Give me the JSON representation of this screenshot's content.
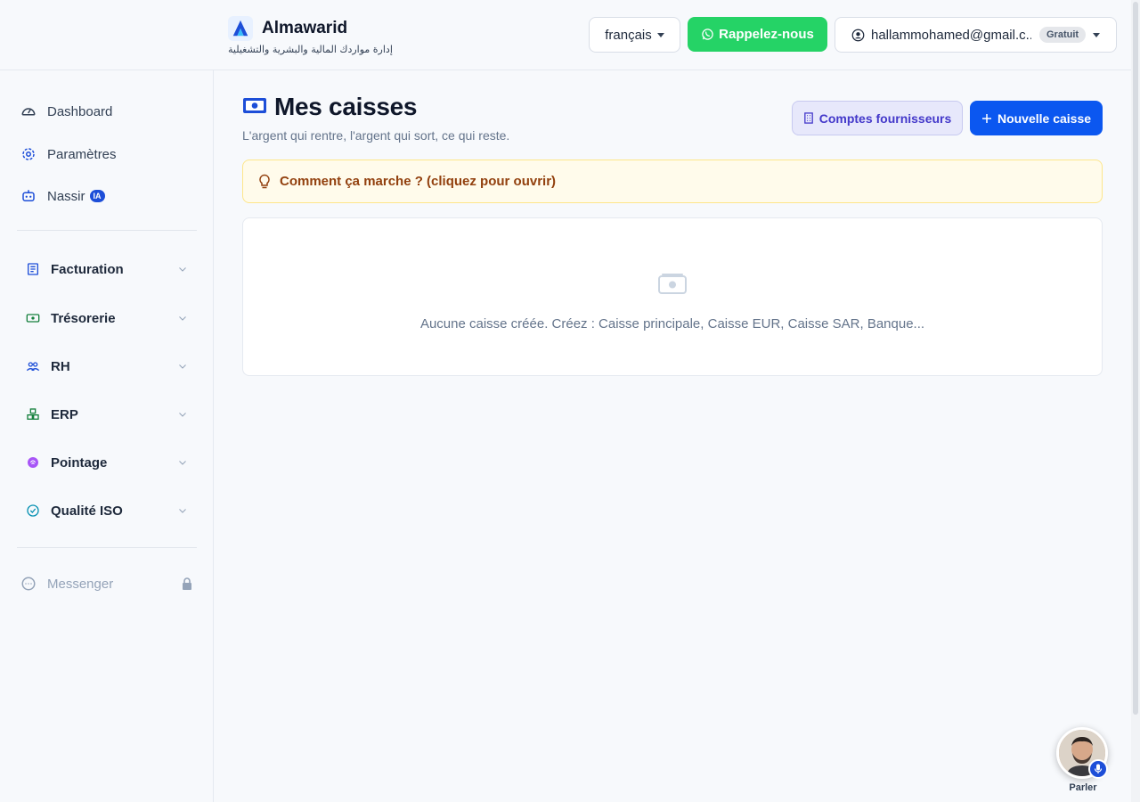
{
  "header": {
    "brand_name": "Almawarid",
    "brand_tagline": "إدارة مواردك المالية والبشرية والتشغيلية",
    "language_label": "français",
    "callback_label": "Rappelez-nous",
    "user_email": "hallammohamed@gmail.c...",
    "plan_badge": "Gratuit"
  },
  "sidebar": {
    "top_items": [
      {
        "label": "Dashboard",
        "icon": "gauge-icon"
      },
      {
        "label": "Paramètres",
        "icon": "gear-icon"
      },
      {
        "label": "Nassir",
        "icon": "robot-icon",
        "badge": "IA"
      }
    ],
    "groups": [
      {
        "label": "Facturation",
        "icon": "invoice-icon"
      },
      {
        "label": "Trésorerie",
        "icon": "cash-icon"
      },
      {
        "label": "RH",
        "icon": "users-icon"
      },
      {
        "label": "ERP",
        "icon": "cubes-icon"
      },
      {
        "label": "Pointage",
        "icon": "fingerprint-icon"
      },
      {
        "label": "Qualité ISO",
        "icon": "check-circle-icon"
      }
    ],
    "messenger_label": "Messenger"
  },
  "main": {
    "title": "Mes caisses",
    "subtitle": "L'argent qui rentre, l'argent qui sort, ce qui reste.",
    "suppliers_button": "Comptes fournisseurs",
    "new_button": "Nouvelle caisse",
    "howto_label": "Comment ça marche ? (cliquez pour ouvrir)",
    "empty_message": "Aucune caisse créée. Créez : Caisse principale, Caisse EUR, Caisse SAR, Banque..."
  },
  "voice_assistant": {
    "label": "Parler"
  },
  "colors": {
    "primary": "#0b57f0",
    "whatsapp": "#25d366",
    "warning_text": "#92400e",
    "suppliers_text": "#4338ca"
  }
}
